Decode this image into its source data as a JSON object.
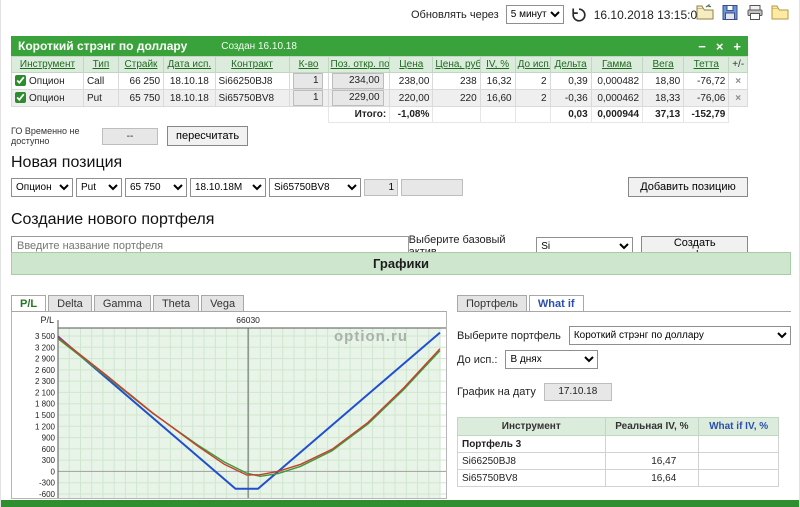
{
  "topbar": {
    "refresh_label": "Обновлять через",
    "refresh_options": [
      "5 минут"
    ],
    "datetime": "16.10.2018 13:15:01",
    "icons": [
      "open-icon",
      "save-icon",
      "print-icon",
      "folder-icon"
    ]
  },
  "portfolio": {
    "title": "Короткий стрэнг по доллару",
    "created": "Создан 16.10.18",
    "minimize_glyph": "−",
    "close_glyph": "×",
    "add_glyph": "+",
    "delete_glyph": "×",
    "table": {
      "headers": [
        "Инструмент",
        "Тип",
        "Страйк",
        "Дата исп.",
        "Контракт",
        "К-во",
        "Поз. откр. по",
        "Цена",
        "Цена, руб.",
        "IV, %",
        "До исп.",
        "Дельта",
        "Гамма",
        "Вега",
        "Тетта",
        "+/-"
      ],
      "rows": [
        {
          "instrument": "Опцион",
          "type": "Call",
          "strike": "66 250",
          "expiry": "18.10.18",
          "contract": "Si66250BJ8",
          "qty": "1",
          "open": "234,00",
          "price": "238,00",
          "price_rub": "238",
          "iv": "16,32",
          "days": "2",
          "delta": "0,39",
          "gamma": "0,000482",
          "vega": "18,80",
          "theta": "-76,72"
        },
        {
          "instrument": "Опцион",
          "type": "Put",
          "strike": "65 750",
          "expiry": "18.10.18",
          "contract": "Si65750BV8",
          "qty": "1",
          "open": "229,00",
          "price": "220,00",
          "price_rub": "220",
          "iv": "16,60",
          "days": "2",
          "delta": "-0,36",
          "gamma": "0,000462",
          "vega": "18,33",
          "theta": "-76,06"
        }
      ],
      "total": {
        "label": "Итого:",
        "value": "-1,08%",
        "delta": "0,03",
        "gamma": "0,000944",
        "vega": "37,13",
        "theta": "-152,79"
      }
    },
    "go": {
      "label": "ГО Временно не доступно",
      "value": "--",
      "recalc_button": "пересчитать"
    }
  },
  "new_position": {
    "heading": "Новая позиция",
    "instrument": "Опцион",
    "type": "Put",
    "strike": "65 750",
    "expiry": "18.10.18М",
    "contract": "Si65750BV8",
    "qty": "1",
    "add_button": "Добавить позицию"
  },
  "new_portfolio": {
    "heading": "Создание нового портфеля",
    "name_placeholder": "Введите название портфеля",
    "asset_label": "Выберите базовый актив",
    "asset_value": "Si",
    "create_button": "Создать портфель"
  },
  "charts": {
    "heading": "Графики",
    "tabs": [
      "P/L",
      "Delta",
      "Gamma",
      "Theta",
      "Vega"
    ],
    "active_tab": "P/L",
    "watermark": "option.ru"
  },
  "chart_data": {
    "type": "line",
    "ylabel": "P/L",
    "x_marker": {
      "value": 66030,
      "label": "66030"
    },
    "xlim": [
      61800,
      70300
    ],
    "ylim": [
      -700,
      3650
    ],
    "y_ticks": [
      "3 500",
      "3 200",
      "2 900",
      "2 600",
      "2 300",
      "2 100",
      "1 800",
      "1 500",
      "1 200",
      "900",
      "600",
      "300",
      "0",
      "-300",
      "-600"
    ],
    "grid": true,
    "legend": "none",
    "series": [
      {
        "name": "expiration",
        "color": "#2050cf",
        "width": 2,
        "points": [
          [
            61800,
            3487
          ],
          [
            65750,
            -463
          ],
          [
            66250,
            -463
          ],
          [
            70300,
            3587
          ]
        ]
      },
      {
        "name": "current",
        "color": "#3a9a3a",
        "width": 1.4,
        "points": [
          [
            61800,
            3430
          ],
          [
            62900,
            2430
          ],
          [
            63900,
            1500
          ],
          [
            64900,
            680
          ],
          [
            65500,
            230
          ],
          [
            66000,
            -60
          ],
          [
            66300,
            -140
          ],
          [
            66700,
            -70
          ],
          [
            67200,
            120
          ],
          [
            67900,
            520
          ],
          [
            68700,
            1220
          ],
          [
            69500,
            2120
          ],
          [
            70300,
            3120
          ]
        ]
      },
      {
        "name": "intermediate",
        "color": "#cc3b2f",
        "width": 1.4,
        "points": [
          [
            61800,
            3470
          ],
          [
            62900,
            2460
          ],
          [
            63900,
            1510
          ],
          [
            64900,
            650
          ],
          [
            65500,
            170
          ],
          [
            66000,
            -110
          ],
          [
            66300,
            -100
          ],
          [
            66700,
            -10
          ],
          [
            67200,
            170
          ],
          [
            67900,
            560
          ],
          [
            68700,
            1260
          ],
          [
            69500,
            2160
          ],
          [
            70300,
            3170
          ]
        ]
      }
    ]
  },
  "whatif": {
    "tabs": [
      "Портфель",
      "What if"
    ],
    "active_tab": "What if",
    "portfolio_label": "Выберите портфель",
    "portfolio_value": "Короткий стрэнг по доллару",
    "days_label": "До исп.:",
    "days_value": "В днях",
    "date_label": "График на дату",
    "date_value": "17.10.18",
    "table": {
      "headers": [
        "Инструмент",
        "Реальная IV, %",
        "What if IV, %"
      ],
      "group_row": "Портфель 3",
      "rows": [
        {
          "instrument": "Si66250BJ8",
          "real_iv": "16,47",
          "whatif_iv": ""
        },
        {
          "instrument": "Si65750BV8",
          "real_iv": "16,64",
          "whatif_iv": ""
        }
      ]
    }
  }
}
